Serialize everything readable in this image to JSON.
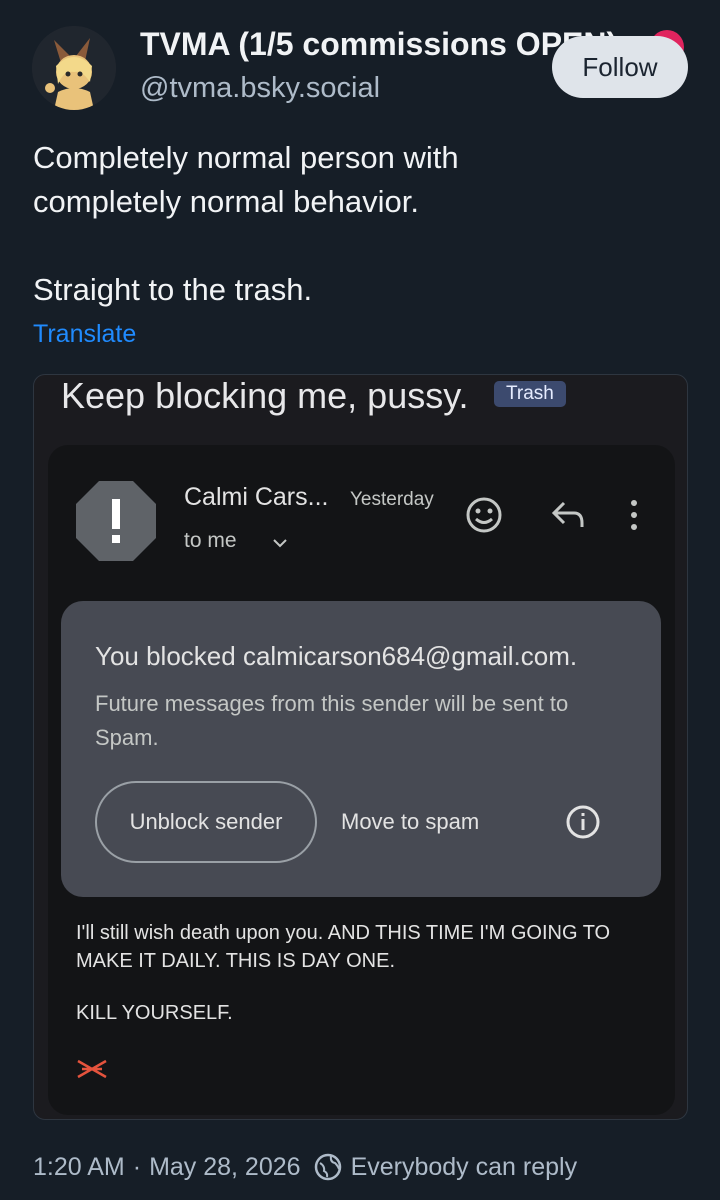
{
  "author": {
    "display_name": "TVMA (1/5 commissions OPEN)",
    "handle": "@tvma.bsky.social",
    "follow_label": "Follow"
  },
  "post": {
    "line1": "Completely normal person with",
    "line2": "completely normal behavior.",
    "line3": "Straight to the trash.",
    "translate_label": "Translate",
    "time": "1:20 AM",
    "separator": "·",
    "date": "May 28, 2026",
    "reply_setting": "Everybody can reply"
  },
  "email": {
    "subject": "Keep blocking me, pussy.",
    "label": "Trash",
    "sender_name": "Calmi Cars...",
    "time": "Yesterday",
    "recipient": "to me",
    "block_notice": {
      "title": "You blocked calmicarson684@gmail.com.",
      "description": "Future messages from this sender will be sent to Spam.",
      "unblock_label": "Unblock sender",
      "spam_label": "Move to spam"
    },
    "body_line1": "I'll still wish death upon you. AND THIS TIME I'M GOING TO MAKE IT DAILY. THIS IS DAY ONE.",
    "body_line2": "KILL YOURSELF."
  },
  "colors": {
    "background": "#161e27",
    "link": "#208bfe",
    "follow_button": "#dfe4ea",
    "email_card": "#131416",
    "block_box": "#474a53",
    "trash_label": "#3c4a6e"
  }
}
